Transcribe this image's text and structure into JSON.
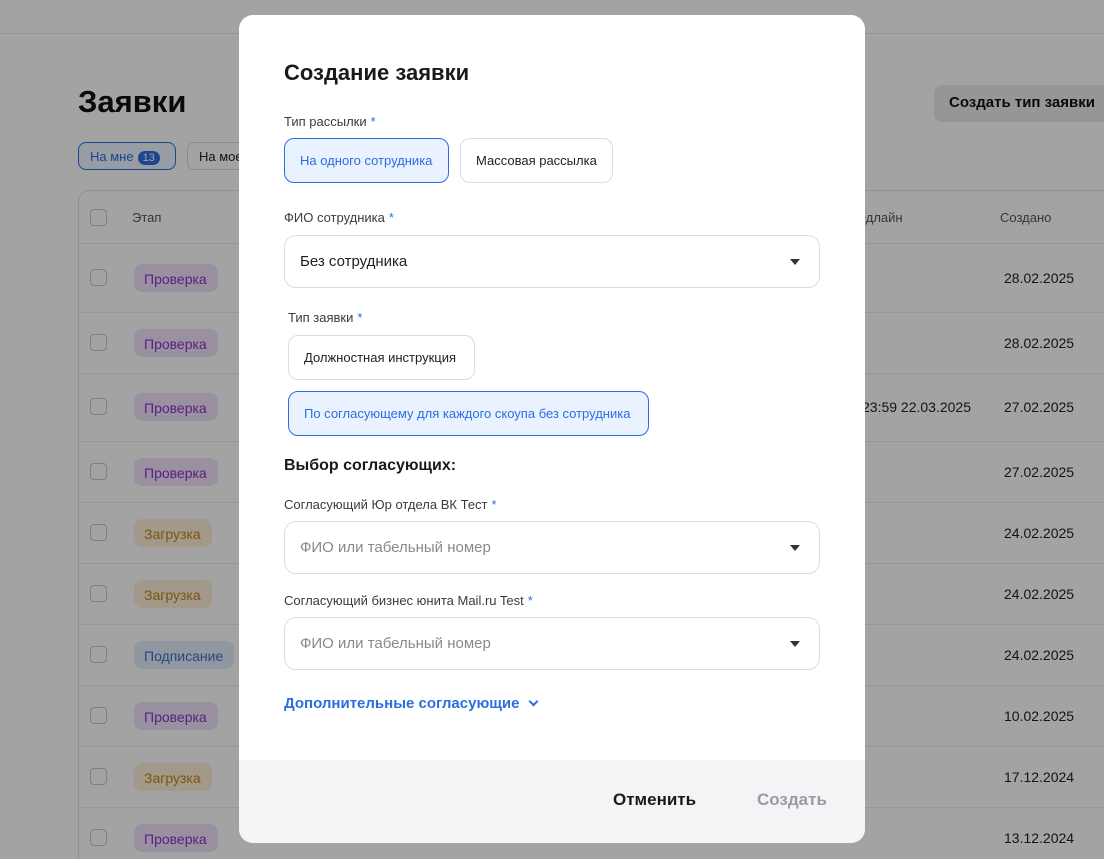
{
  "background": {
    "title": "Заявки",
    "create_type_button": "Создать тип заявки",
    "filters": [
      {
        "label": "На мне",
        "count": "13"
      },
      {
        "label": "На мое"
      }
    ],
    "columns": {
      "stage": "Этап",
      "deadline": "Дедлайн",
      "created": "Создано"
    },
    "rows": [
      {
        "stage": "Проверка",
        "kind": "check",
        "deadline": "",
        "created": "28.02.2025"
      },
      {
        "stage": "Проверка",
        "kind": "check",
        "deadline": "",
        "created": "28.02.2025"
      },
      {
        "stage": "Проверка",
        "kind": "check",
        "deadline": "23:59 22.03.2025",
        "created": "27.02.2025"
      },
      {
        "stage": "Проверка",
        "kind": "check",
        "deadline": "",
        "created": "27.02.2025"
      },
      {
        "stage": "Загрузка",
        "kind": "load",
        "deadline": "",
        "created": "24.02.2025"
      },
      {
        "stage": "Загрузка",
        "kind": "load",
        "deadline": "",
        "created": "24.02.2025"
      },
      {
        "stage": "Подписание",
        "kind": "sign",
        "deadline": "",
        "created": "24.02.2025"
      },
      {
        "stage": "Проверка",
        "kind": "check",
        "deadline": "",
        "created": "10.02.2025"
      },
      {
        "stage": "Загрузка",
        "kind": "load",
        "deadline": "",
        "created": "17.12.2024"
      },
      {
        "stage": "Проверка",
        "kind": "check",
        "deadline": "",
        "created": "13.12.2024"
      }
    ]
  },
  "modal": {
    "title": "Создание заявки",
    "mailing_type": {
      "label": "Тип рассылки",
      "required": "*",
      "options": [
        "На одного сотрудника",
        "Массовая рассылка"
      ],
      "selected": 0
    },
    "employee": {
      "label": "ФИО сотрудника",
      "required": "*",
      "value": "Без сотрудника"
    },
    "request_type": {
      "label": "Тип заявки",
      "required": "*",
      "options": [
        "Должностная инструкция",
        "По согласующему для каждого скоупа без сотрудника"
      ],
      "selected": 1
    },
    "approvers_title": "Выбор согласующих:",
    "approver_legal": {
      "label": "Согласующий Юр отдела ВК Тест",
      "required": "*",
      "placeholder": "ФИО или табельный номер"
    },
    "approver_business": {
      "label": "Согласующий бизнес юнита Mail.ru Test",
      "required": "*",
      "placeholder": "ФИО или табельный номер"
    },
    "more_approvers": "Дополнительные согласующие",
    "cancel": "Отменить",
    "create": "Создать"
  },
  "colors": {
    "accent": "#2c6ee0",
    "stage_check": "#8a35c9",
    "stage_load": "#c48513",
    "stage_sign": "#3c6fc8"
  }
}
